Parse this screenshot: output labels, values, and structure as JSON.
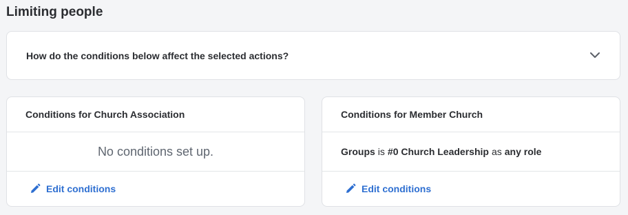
{
  "page": {
    "title": "Limiting people"
  },
  "accordion": {
    "question": "How do the conditions below affect the selected actions?",
    "icon": "chevron-down-icon"
  },
  "cards": {
    "church_association": {
      "title": "Conditions for Church Association",
      "empty_text": "No conditions set up.",
      "edit_label": "Edit conditions",
      "edit_icon": "pencil-icon"
    },
    "member_church": {
      "title": "Conditions for Member Church",
      "rule": {
        "field": "Groups",
        "operator": "is",
        "value": "#0 Church Leadership",
        "qualifier": "as",
        "role": "any role"
      },
      "edit_label": "Edit conditions",
      "edit_icon": "pencil-icon"
    }
  },
  "colors": {
    "background": "#f4f5f7",
    "link": "#2e6fd1",
    "border": "#dfe1e5",
    "muted_text": "#5f6670"
  }
}
